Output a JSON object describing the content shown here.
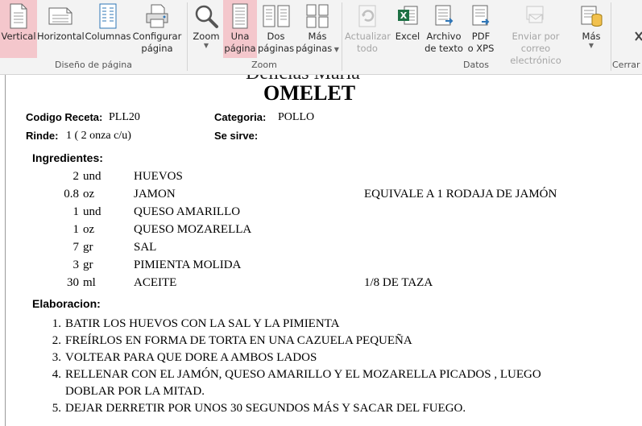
{
  "ribbon": {
    "buttons": {
      "vertical": "Vertical",
      "horizontal": "Horizontal",
      "columnas": "Columnas",
      "configurar_1": "Configurar",
      "configurar_2": "página",
      "zoom": "Zoom",
      "una_1": "Una",
      "una_2": "página",
      "dos_1": "Dos",
      "dos_2": "páginas",
      "mas_paginas_1": "Más",
      "mas_paginas_2": "páginas",
      "actualizar_1": "Actualizar",
      "actualizar_2": "todo",
      "excel": "Excel",
      "archivo_1": "Archivo",
      "archivo_2": "de texto",
      "pdf_1": "PDF",
      "pdf_2": "o XPS",
      "correo_1": "Enviar por correo",
      "correo_2": "electrónico",
      "mas": "Más",
      "cerrar": "Cerrar v"
    },
    "groups": {
      "diseno": "Diseño de página",
      "zoom": "Zoom",
      "datos": "Datos"
    }
  },
  "document": {
    "header_cut": "Delicias Maria",
    "title": "OMELET",
    "codigo_label": "Codigo Receta:",
    "codigo_value": "PLL20",
    "categoria_label": "Categoria:",
    "categoria_value": "POLLO",
    "rinde_label": "Rinde:",
    "rinde_value": "1 ( 2 onza c/u)",
    "sesirve_label": "Se sirve:",
    "ingredientes_label": "Ingredientes:",
    "ingredients": [
      {
        "qty": "2",
        "unit": "und",
        "name": "HUEVOS",
        "note": ""
      },
      {
        "qty": "0.8",
        "unit": "oz",
        "name": "JAMON",
        "note": "EQUIVALE A 1  RODAJA DE JAMÓN"
      },
      {
        "qty": "1",
        "unit": "und",
        "name": "QUESO AMARILLO",
        "note": ""
      },
      {
        "qty": "1",
        "unit": "oz",
        "name": "QUESO MOZARELLA",
        "note": ""
      },
      {
        "qty": "7",
        "unit": "gr",
        "name": "SAL",
        "note": ""
      },
      {
        "qty": "3",
        "unit": "gr",
        "name": "PIMIENTA MOLIDA",
        "note": ""
      },
      {
        "qty": "30",
        "unit": "ml",
        "name": "ACEITE",
        "note": "1/8 DE TAZA"
      }
    ],
    "elaboracion_label": "Elaboracion:",
    "steps": [
      {
        "num": "1.",
        "line1": "BATIR LOS HUEVOS CON LA SAL Y LA PIMIENTA",
        "line2": ""
      },
      {
        "num": "2.",
        "line1": "FREÍRLOS EN FORMA DE TORTA EN UNA CAZUELA PEQUEÑA",
        "line2": ""
      },
      {
        "num": "3.",
        "line1": "VOLTEAR PARA QUE DORE A AMBOS LADOS",
        "line2": ""
      },
      {
        "num": "4.",
        "line1": "RELLENAR  CON EL JAMÓN, QUESO AMARILLO Y EL MOZARELLA PICADOS , LUEGO",
        "line2": "DOBLAR POR LA MITAD."
      },
      {
        "num": "5.",
        "line1": "DEJAR DERRETIR POR UNOS 30 SEGUNDOS MÁS Y SACAR DEL FUEGO.",
        "line2": ""
      }
    ]
  }
}
